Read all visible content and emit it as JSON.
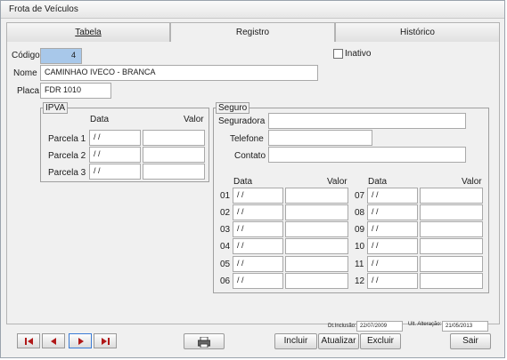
{
  "window": {
    "title": "Frota de Veículos"
  },
  "tabs": [
    {
      "label": "Tabela"
    },
    {
      "label": "Registro"
    },
    {
      "label": "Histórico"
    }
  ],
  "registro": {
    "codigo_label": "Código",
    "codigo_value": "4",
    "inativo_label": "Inativo",
    "inativo_checked": false,
    "nome_label": "Nome",
    "nome_value": "CAMINHAO IVECO - BRANCA",
    "placa_label": "Placa",
    "placa_value": "FDR 1010"
  },
  "ipva": {
    "legend": "IPVA",
    "col_data": "Data",
    "col_valor": "Valor",
    "parcelas": [
      {
        "label": "Parcela 1",
        "data": "/ /",
        "valor": ""
      },
      {
        "label": "Parcela 2",
        "data": "/ /",
        "valor": ""
      },
      {
        "label": "Parcela 3",
        "data": "/ /",
        "valor": ""
      }
    ]
  },
  "seguro": {
    "legend": "Seguro",
    "seguradora_label": "Seguradora",
    "seguradora_value": "",
    "telefone_label": "Telefone",
    "telefone_value": "",
    "contato_label": "Contato",
    "contato_value": "",
    "col_data": "Data",
    "col_valor": "Valor",
    "left": [
      {
        "num": "01",
        "data": "/ /",
        "valor": ""
      },
      {
        "num": "02",
        "data": "/ /",
        "valor": ""
      },
      {
        "num": "03",
        "data": "/ /",
        "valor": ""
      },
      {
        "num": "04",
        "data": "/ /",
        "valor": ""
      },
      {
        "num": "05",
        "data": "/ /",
        "valor": ""
      },
      {
        "num": "06",
        "data": "/ /",
        "valor": ""
      }
    ],
    "right": [
      {
        "num": "07",
        "data": "/ /",
        "valor": ""
      },
      {
        "num": "08",
        "data": "/ /",
        "valor": ""
      },
      {
        "num": "09",
        "data": "/ /",
        "valor": ""
      },
      {
        "num": "10",
        "data": "/ /",
        "valor": ""
      },
      {
        "num": "11",
        "data": "/ /",
        "valor": ""
      },
      {
        "num": "12",
        "data": "/ /",
        "valor": ""
      }
    ]
  },
  "status": {
    "inclusao_label": "Dt.Inclusão:",
    "inclusao_value": "22/07/2009",
    "alteracao_label": "Ult. Alteração:",
    "alteracao_value": "21/05/2013"
  },
  "toolbar": {
    "incluir": "Incluir",
    "atualizar": "Atualizar",
    "excluir": "Excluir",
    "sair": "Sair"
  },
  "icons": {
    "first": "first-record-icon",
    "prev": "previous-record-icon",
    "next": "next-record-icon",
    "last": "last-record-icon",
    "print": "printer-icon"
  }
}
